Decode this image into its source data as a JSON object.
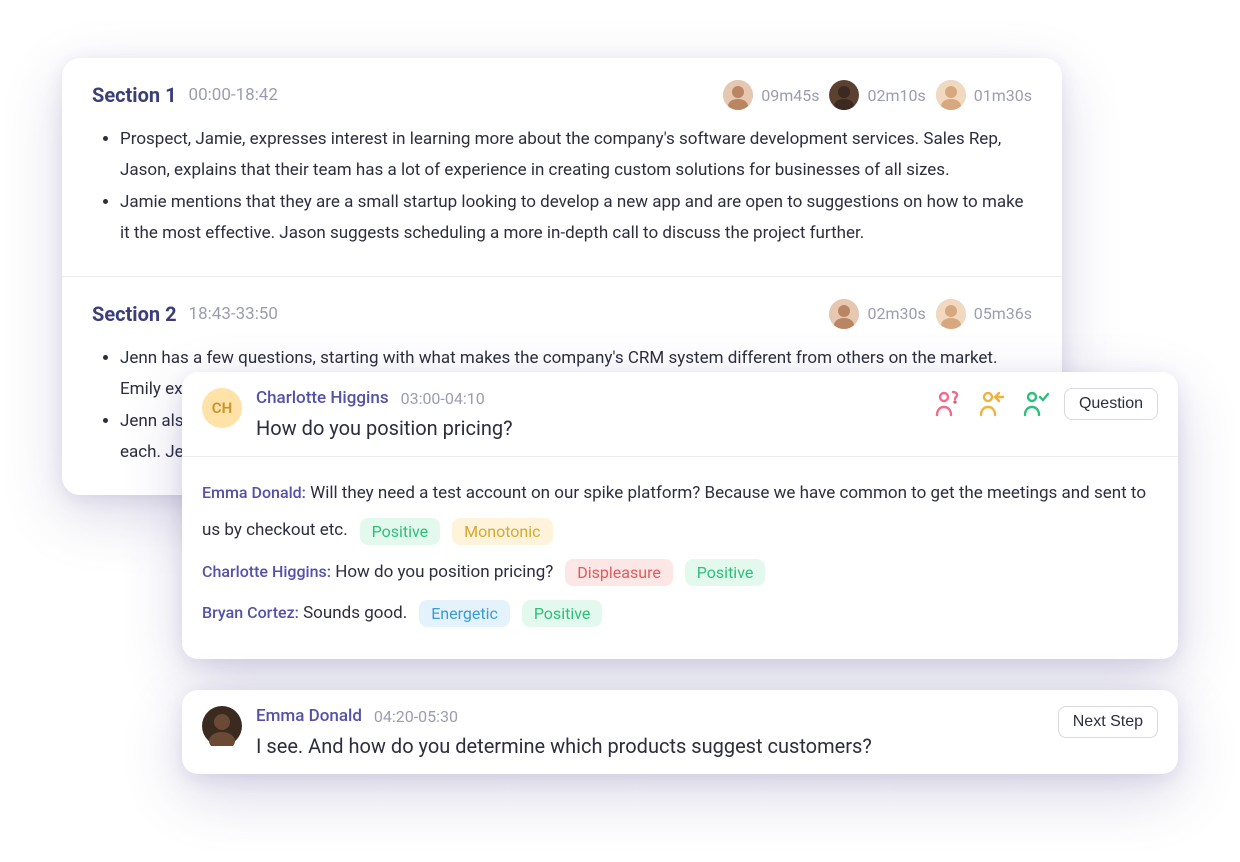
{
  "sections": [
    {
      "title": "Section 1",
      "timerange": "00:00-18:42",
      "participants": [
        {
          "time": "09m45s",
          "bg": "#e6c8b0",
          "face": "#b98562"
        },
        {
          "time": "02m10s",
          "bg": "#5c4030",
          "face": "#3a2a20"
        },
        {
          "time": "01m30s",
          "bg": "#f1d9c0",
          "face": "#d7a87f"
        }
      ],
      "bullets": [
        "Prospect, Jamie, expresses interest in learning more about the company's software development services. Sales Rep, Jason, explains that their team has a lot of experience in creating custom solutions for businesses of all sizes.",
        "Jamie mentions that they are a small startup looking to develop a new app and are open to suggestions on how to make it the most effective. Jason suggests scheduling a more in-depth call to discuss the project further."
      ]
    },
    {
      "title": "Section 2",
      "timerange": "18:43-33:50",
      "participants": [
        {
          "time": "02m30s",
          "bg": "#e6c8b0",
          "face": "#b98562"
        },
        {
          "time": "05m36s",
          "bg": "#f1d9c0",
          "face": "#d7a87f"
        }
      ],
      "bullets": [
        "Jenn has a few questions, starting with what makes the company's CRM system different from others on the market. Emily explains that their CRM system is tailored to small to medium-sized businesses and has an intuitive",
        "Jenn also asks about the pricing structure, and Emily walks them through the different pricing plans and information on each. Jenn expresses interest in the mid-tier plan and asks if there are any discounts or any additional"
      ]
    }
  ],
  "snippet1": {
    "initials": "CH",
    "speaker": "Charlotte Higgins",
    "timerange": "03:00-04:10",
    "question": "How do you position pricing?",
    "tag": "Question",
    "action_icons": [
      {
        "name": "person-question-icon",
        "color": "#f36a8a"
      },
      {
        "name": "person-reply-icon",
        "color": "#f0b23e"
      },
      {
        "name": "person-check-icon",
        "color": "#2bbf7a"
      }
    ],
    "transcript": [
      {
        "speaker": "Emma Donald:",
        "text": " Will they need a test account on our spike platform? Because we have common to get the meetings and sent to us by checkout etc.",
        "tags": [
          {
            "label": "Positive",
            "cls": "tag-positive"
          },
          {
            "label": "Monotonic",
            "cls": "tag-monotonic"
          }
        ]
      },
      {
        "speaker": "Charlotte Higgins:",
        "text": " How do you position pricing?",
        "tags": [
          {
            "label": "Displeasure",
            "cls": "tag-displeasure"
          },
          {
            "label": "Positive",
            "cls": "tag-positive"
          }
        ]
      },
      {
        "speaker": "Bryan Cortez:",
        "text": " Sounds good.",
        "tags": [
          {
            "label": "Energetic",
            "cls": "tag-energetic"
          },
          {
            "label": "Positive",
            "cls": "tag-positive"
          }
        ]
      }
    ]
  },
  "snippet2": {
    "speaker": "Emma Donald",
    "timerange": "04:20-05:30",
    "question": "I see. And how do you determine which products suggest customers?",
    "tag": "Next Step",
    "avatar": {
      "bg": "#3a2a20",
      "face": "#6b4a35"
    }
  }
}
